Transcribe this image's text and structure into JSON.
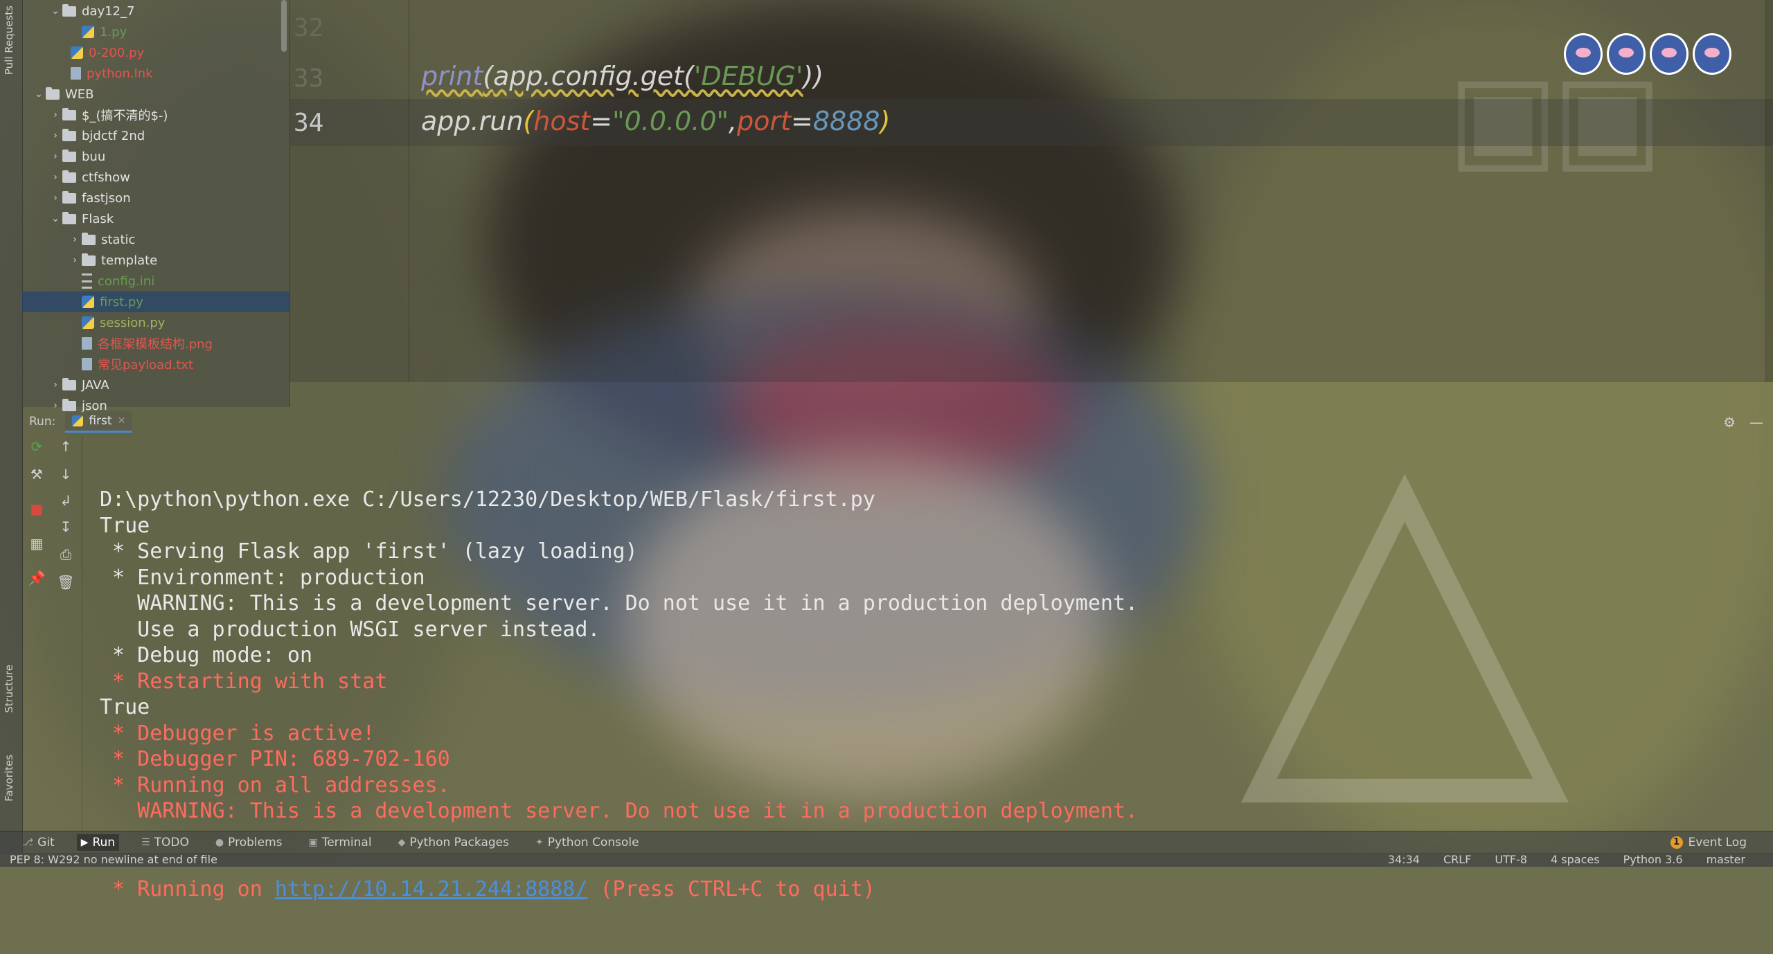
{
  "side_tabs": {
    "pull_requests": "Pull Requests",
    "structure": "Structure",
    "favorites": "Favorites"
  },
  "tree": {
    "items": [
      {
        "label": "day12_7",
        "type": "folder",
        "color": "white",
        "expanded": true
      },
      {
        "label": "1.py",
        "type": "py",
        "color": "green"
      },
      {
        "label": "0-200.py",
        "type": "py",
        "color": "red"
      },
      {
        "label": "python.lnk",
        "type": "file",
        "color": "red"
      },
      {
        "label": "WEB",
        "type": "folder",
        "color": "white",
        "expanded": true
      },
      {
        "label": "$_(搞不清的$-)",
        "type": "folder",
        "color": "white"
      },
      {
        "label": "bjdctf 2nd",
        "type": "folder",
        "color": "white"
      },
      {
        "label": "buu",
        "type": "folder",
        "color": "white"
      },
      {
        "label": "ctfshow",
        "type": "folder",
        "color": "white"
      },
      {
        "label": "fastjson",
        "type": "folder",
        "color": "white"
      },
      {
        "label": "Flask",
        "type": "folder",
        "color": "white",
        "expanded": true
      },
      {
        "label": "static",
        "type": "folder",
        "color": "white"
      },
      {
        "label": "template",
        "type": "folder",
        "color": "white"
      },
      {
        "label": "config.ini",
        "type": "ini",
        "color": "green"
      },
      {
        "label": "first.py",
        "type": "py",
        "color": "green",
        "selected": true
      },
      {
        "label": "session.py",
        "type": "py",
        "color": "olive"
      },
      {
        "label": "各框架模板结构.png",
        "type": "file",
        "color": "red"
      },
      {
        "label": "常见payload.txt",
        "type": "file",
        "color": "red"
      },
      {
        "label": "JAVA",
        "type": "folder",
        "color": "white"
      },
      {
        "label": "json",
        "type": "folder",
        "color": "white"
      }
    ]
  },
  "editor": {
    "line_numbers": [
      "32",
      "33",
      "34"
    ],
    "line33": {
      "fn": "print",
      "open": "(",
      "obj": "app.config.get(",
      "str": "'DEBUG'",
      "close": "))"
    },
    "line34": {
      "obj": "app.run",
      "open": "(",
      "host_kw": "host",
      "eq1": "=",
      "host_val": "\"0.0.0.0\"",
      "comma": ",",
      "port_kw": "port",
      "eq2": "=",
      "port_val": "8888",
      "close": ")"
    }
  },
  "run": {
    "label": "Run:",
    "tab": "first",
    "console": [
      {
        "text": "D:\\python\\python.exe C:/Users/12230/Desktop/WEB/Flask/first.py",
        "color": "white"
      },
      {
        "text": "True",
        "color": "white"
      },
      {
        "text": " * Serving Flask app 'first' (lazy loading)",
        "color": "white"
      },
      {
        "text": " * Environment: production",
        "color": "white"
      },
      {
        "text": "   WARNING: This is a development server. Do not use it in a production deployment.",
        "color": "white"
      },
      {
        "text": "   Use a production WSGI server instead.",
        "color": "white"
      },
      {
        "text": " * Debug mode: on",
        "color": "white"
      },
      {
        "text": " * Restarting with stat",
        "color": "red"
      },
      {
        "text": "True",
        "color": "white"
      },
      {
        "text": " * Debugger is active!",
        "color": "red"
      },
      {
        "text": " * Debugger PIN: 689-702-160",
        "color": "red"
      },
      {
        "text": " * Running on all addresses.",
        "color": "red"
      },
      {
        "text": "   WARNING: This is a development server. Do not use it in a production deployment.",
        "color": "red"
      }
    ],
    "last_line": {
      "prefix": " * Running on ",
      "link": "http://10.14.21.244:8888/",
      "suffix": " (Press CTRL+C to quit)"
    }
  },
  "toolbar": {
    "items": [
      {
        "label": "Git",
        "icon": "git-icon"
      },
      {
        "label": "Run",
        "icon": "run-icon",
        "active": true
      },
      {
        "label": "TODO",
        "icon": "todo-icon"
      },
      {
        "label": "Problems",
        "icon": "problems-icon"
      },
      {
        "label": "Terminal",
        "icon": "terminal-icon"
      },
      {
        "label": "Python Packages",
        "icon": "packages-icon"
      },
      {
        "label": "Python Console",
        "icon": "python-console-icon"
      }
    ],
    "event_log": "Event Log",
    "event_count": "1"
  },
  "status": {
    "message": "PEP 8: W292 no newline at end of file",
    "position": "34:34",
    "line_sep": "CRLF",
    "encoding": "UTF-8",
    "indent": "4 spaces",
    "interpreter": "Python 3.6",
    "branch": "master"
  },
  "colors": {
    "string": "#6a9955",
    "keyword_arg": "#d0573c",
    "number": "#6897bb",
    "error_red": "#ff6b5e",
    "link": "#4a8fe0"
  }
}
